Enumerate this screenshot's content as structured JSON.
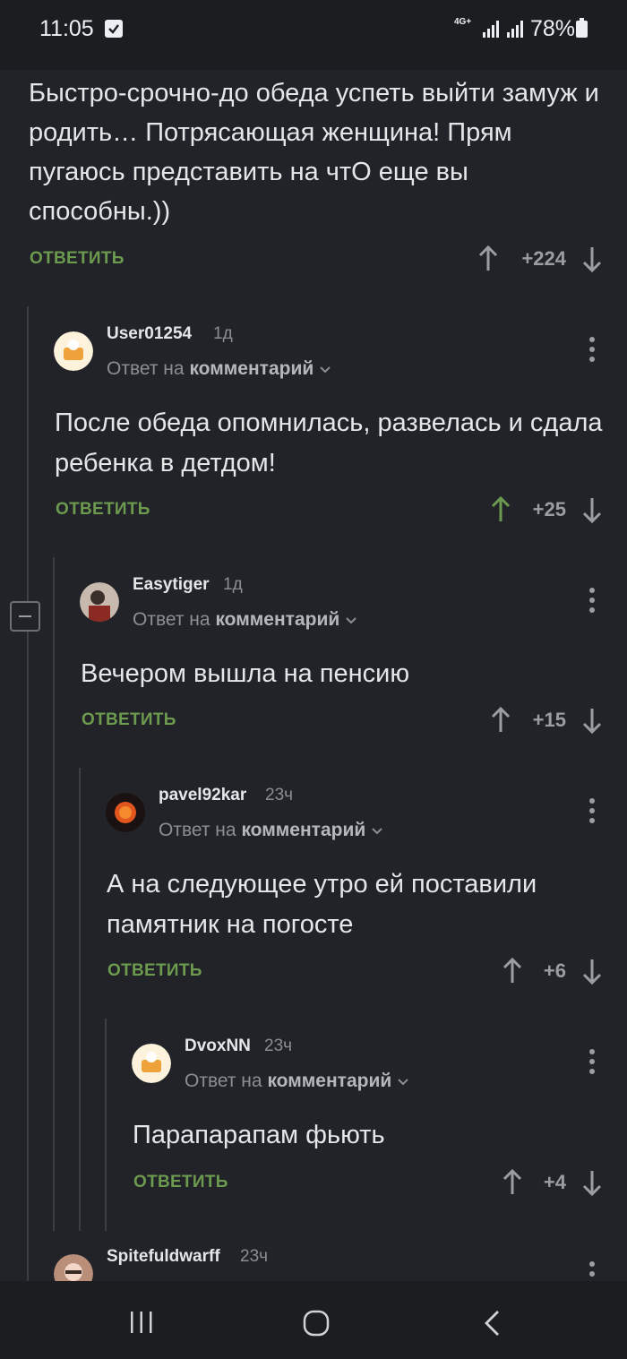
{
  "status_bar": {
    "time": "11:05",
    "network": "4G+",
    "battery": "78%"
  },
  "top_comment": {
    "text": "Быстро-срочно-до обеда успеть выйти замуж и родить… Потрясающая женщина! Прям пугаюсь представить на чтО еще вы способны.))",
    "reply_label": "ОТВЕТИТЬ",
    "score": "+224"
  },
  "comments": [
    {
      "username": "User01254",
      "ago": "1д",
      "answer_prefix": "Ответ на",
      "answer_link": "комментарий",
      "text": "После обеда опомнилась, развелась и сдала ребенка в детдом!",
      "reply_label": "ОТВЕТИТЬ",
      "score": "+25",
      "upvoted": true
    },
    {
      "username": "Easytiger",
      "ago": "1д",
      "answer_prefix": "Ответ на",
      "answer_link": "комментарий",
      "text": "Вечером вышла на пенсию",
      "reply_label": "ОТВЕТИТЬ",
      "score": "+15",
      "upvoted": false
    },
    {
      "username": "pavel92kar",
      "ago": "23ч",
      "answer_prefix": "Ответ на",
      "answer_link": "комментарий",
      "text": "А на следующее утро ей поставили памятник на погосте",
      "reply_label": "ОТВЕТИТЬ",
      "score": "+6",
      "upvoted": false
    },
    {
      "username": "DvoxNN",
      "ago": "23ч",
      "answer_prefix": "Ответ на",
      "answer_link": "комментарий",
      "text": "Парапарапам фьють",
      "reply_label": "ОТВЕТИТЬ",
      "score": "+4",
      "upvoted": false
    },
    {
      "username": "Spitefuldwarff",
      "ago": "23ч"
    }
  ],
  "colors": {
    "background": "#212328",
    "reply_green": "#6c9a4e",
    "upvote_active": "#6c9a4e"
  }
}
